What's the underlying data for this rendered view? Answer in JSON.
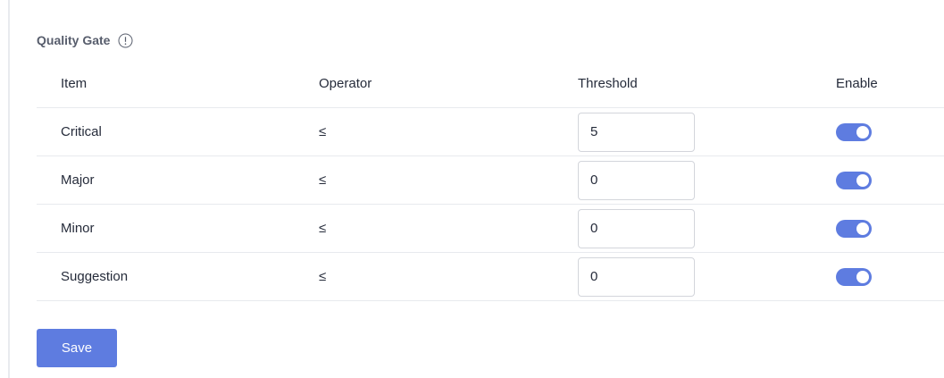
{
  "panel": {
    "title": "Quality Gate",
    "info_icon": "info-icon"
  },
  "table": {
    "headers": {
      "item": "Item",
      "operator": "Operator",
      "threshold": "Threshold",
      "enable": "Enable"
    },
    "rows": [
      {
        "item": "Critical",
        "operator": "≤",
        "threshold": "5",
        "enabled": true
      },
      {
        "item": "Major",
        "operator": "≤",
        "threshold": "0",
        "enabled": true
      },
      {
        "item": "Minor",
        "operator": "≤",
        "threshold": "0",
        "enabled": true
      },
      {
        "item": "Suggestion",
        "operator": "≤",
        "threshold": "0",
        "enabled": true
      }
    ]
  },
  "actions": {
    "save_label": "Save"
  },
  "colors": {
    "accent": "#5e7ce0",
    "title_text": "#575d6c",
    "body_text": "#252b3a",
    "divider": "#e8eaee"
  }
}
